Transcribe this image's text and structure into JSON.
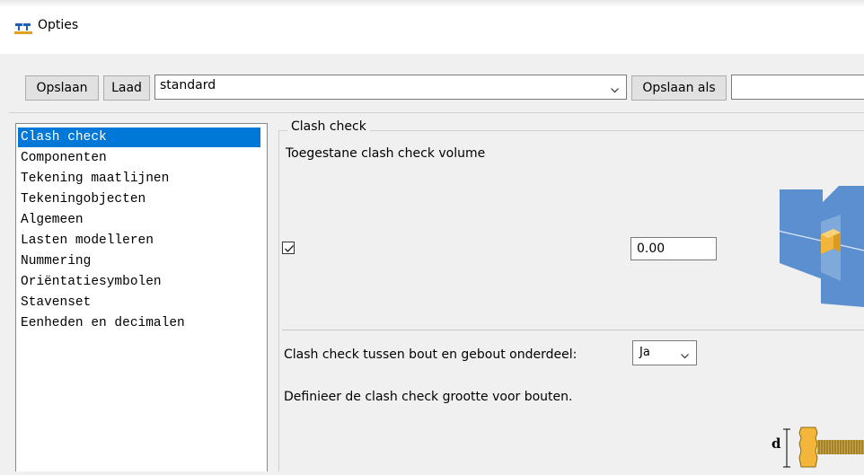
{
  "window": {
    "title": "Opties"
  },
  "toolbar": {
    "save_label": "Opslaan",
    "load_label": "Laad",
    "preset_value": "standard",
    "save_as_label": "Opslaan als",
    "save_as_name": ""
  },
  "nav": {
    "items": [
      "Clash check",
      "Componenten",
      "Tekening maatlijnen",
      "Tekeningobjecten",
      "Algemeen",
      "Lasten modelleren",
      "Nummering",
      "Oriëntatiesymbolen",
      "Stavenset",
      "Eenheden en decimalen"
    ],
    "selected_index": 0
  },
  "clash": {
    "group_title": "Clash check",
    "volume_label": "Toegestane clash check volume",
    "volume_checked": true,
    "volume_value": "0.00",
    "bolt_label": "Clash check tussen bout en gebout onderdeel:",
    "bolt_value": "Ja",
    "bolt_size_label": "Definieer de clash check grootte voor bouten.",
    "dimension_label": "d"
  },
  "colors": {
    "selection": "#0078d7",
    "plate_blue": "#5b8fcf",
    "clash_orange": "#f4b63a"
  }
}
